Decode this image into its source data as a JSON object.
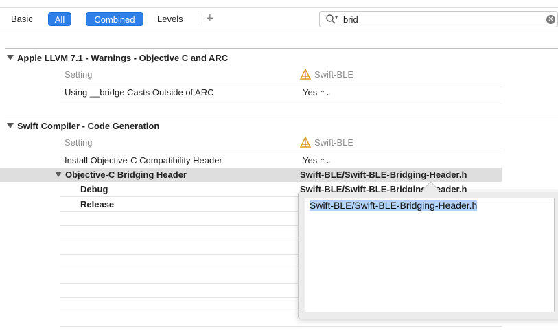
{
  "toolbar": {
    "basic": "Basic",
    "all": "All",
    "combined": "Combined",
    "levels": "Levels",
    "add": "+"
  },
  "search": {
    "value": "brid"
  },
  "sections": [
    {
      "title": "Apple LLVM 7.1 - Warnings - Objective C and ARC",
      "setting_header": "Setting",
      "target_header": "Swift-BLE",
      "rows": [
        {
          "name": "Using __bridge Casts Outside of ARC",
          "value": "Yes"
        }
      ]
    },
    {
      "title": "Swift Compiler - Code Generation",
      "setting_header": "Setting",
      "target_header": "Swift-BLE",
      "rows": [
        {
          "name": "Install Objective-C Compatibility Header",
          "value": "Yes"
        },
        {
          "name": "Objective-C Bridging Header",
          "value": "Swift-BLE/Swift-BLE-Bridging-Header.h"
        },
        {
          "name": "Debug",
          "value": "Swift-BLE/Swift-BLE-Bridging-Header.h"
        },
        {
          "name": "Release",
          "value": ""
        }
      ]
    }
  ],
  "popover": {
    "text": "Swift-BLE/Swift-BLE-Bridging-Header.h"
  },
  "colors": {
    "accent": "#2f7fe8",
    "selection": "#b3d3fb",
    "row_highlight": "#dedede"
  }
}
